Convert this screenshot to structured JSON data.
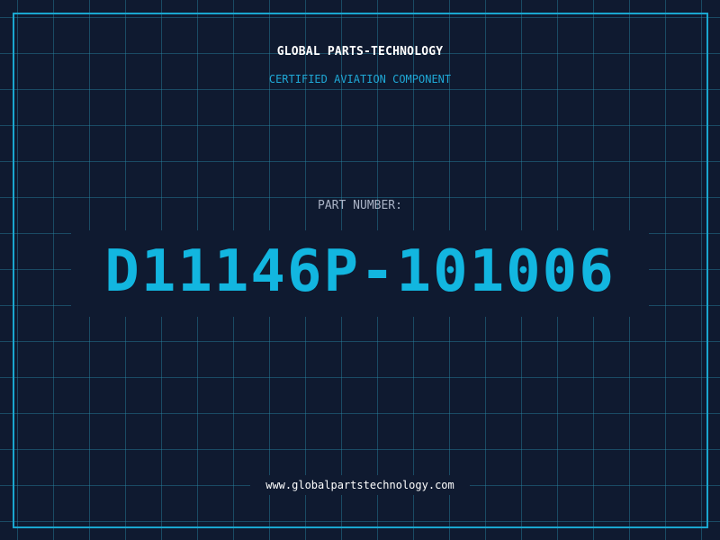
{
  "header": {
    "company": "GLOBAL PARTS-TECHNOLOGY",
    "subtitle": "CERTIFIED AVIATION COMPONENT"
  },
  "part": {
    "label": "PART NUMBER:",
    "number": "D11146P-101006"
  },
  "footer": {
    "url": "www.globalpartstechnology.com"
  },
  "colors": {
    "background": "#0f1a30",
    "grid": "#288caa",
    "accent": "#1aa6cf",
    "part_number": "#12b6e0",
    "label": "#aab3c6",
    "text": "#ffffff"
  }
}
